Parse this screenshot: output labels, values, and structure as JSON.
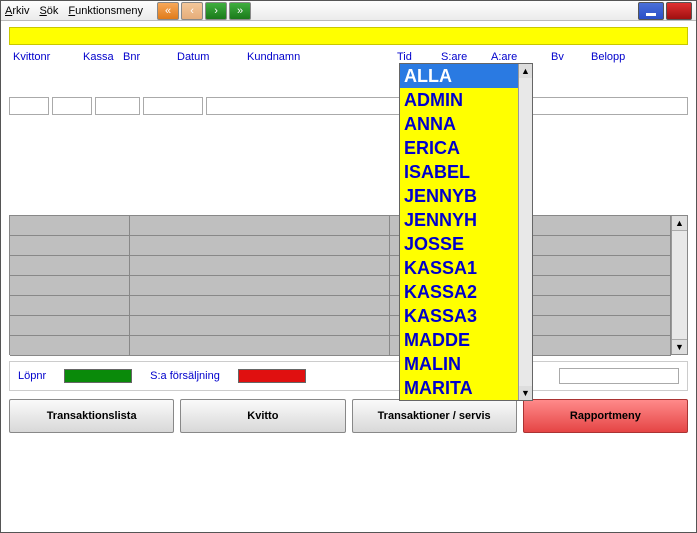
{
  "menu": {
    "arkiv": "Arkiv",
    "sok": "Sök",
    "funktionsmeny": "Funktionsmeny"
  },
  "headers": {
    "kvittonr": "Kvittonr",
    "kassa": "Kassa",
    "bnr": "Bnr",
    "datum": "Datum",
    "kundnamn": "Kundnamn",
    "tid": "Tid",
    "sare": "S:are",
    "aare": "A:are",
    "bv": "Bv",
    "belopp": "Belopp"
  },
  "summary": {
    "lopnr": "Löpnr",
    "sa_forsaljning": "S:a försäljning"
  },
  "buttons": {
    "transaktionslista": "Transaktionslista",
    "kvitto": "Kvitto",
    "transaktioner_servis": "Transaktioner / servis",
    "rapportmeny": "Rapportmeny"
  },
  "dropdown": {
    "selected_index": 0,
    "items": [
      "ALLA",
      "ADMIN",
      "ANNA",
      "ERICA",
      "ISABEL",
      "JENNYB",
      "JENNYH",
      "JOSSE",
      "KASSA1",
      "KASSA2",
      "KASSA3",
      "MADDE",
      "MALIN",
      "MARITA"
    ]
  }
}
